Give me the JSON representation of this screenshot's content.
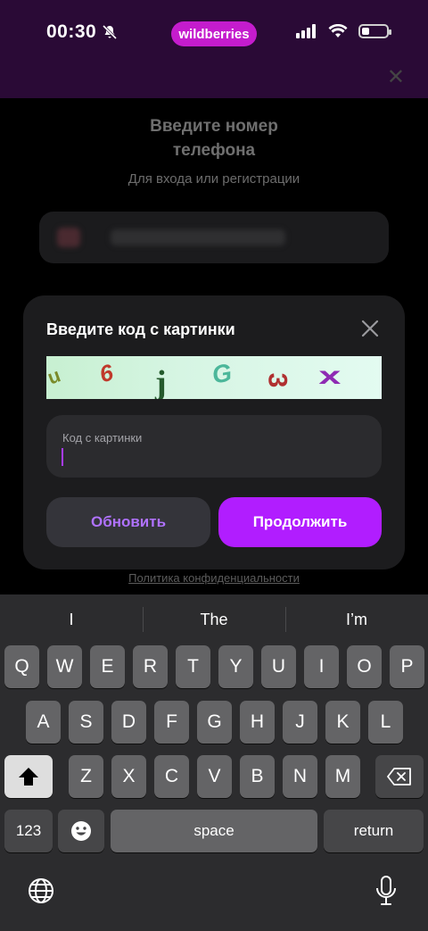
{
  "status_bar": {
    "time": "00:30",
    "app_pill": "wildberries",
    "icons": [
      "bell-slash-icon",
      "signal-icon",
      "wifi-icon",
      "battery-icon"
    ]
  },
  "background_page": {
    "title_line1": "Введите номер",
    "title_line2": "телефона",
    "subtitle": "Для входа или регистрации",
    "privacy_link": "Политика конфиденциальности"
  },
  "modal": {
    "title": "Введите код с картинки",
    "captcha_chars": [
      "u",
      "6",
      "j",
      "G",
      "3",
      "x"
    ],
    "input_label": "Код с картинки",
    "input_value": "",
    "refresh_label": "Обновить",
    "continue_label": "Продолжить"
  },
  "keyboard": {
    "suggestions": [
      "I",
      "The",
      "I’m"
    ],
    "row1": [
      "Q",
      "W",
      "E",
      "R",
      "T",
      "Y",
      "U",
      "I",
      "O",
      "P"
    ],
    "row2": [
      "A",
      "S",
      "D",
      "F",
      "G",
      "H",
      "J",
      "K",
      "L"
    ],
    "row3": [
      "Z",
      "X",
      "C",
      "V",
      "B",
      "N",
      "M"
    ],
    "numbers_label": "123",
    "space_label": "space",
    "return_label": "return"
  },
  "colors": {
    "accent": "#b11dff",
    "brand_pill": "#c41ccd",
    "status_bg": "#2a0a36"
  }
}
